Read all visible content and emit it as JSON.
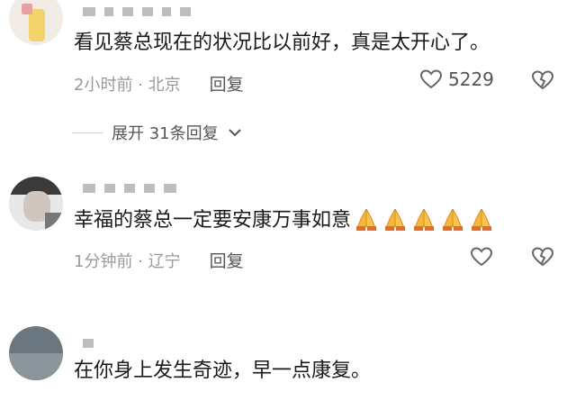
{
  "comments": [
    {
      "text": "看见蔡总现在的状况比以前好，真是太开心了。",
      "time": "2小时前 · 北京",
      "reply": "回复",
      "likes": "5229"
    },
    {
      "text": "幸福的蔡总一定要安康万事如意",
      "emoji_count": 5,
      "emoji": "folded-hands-icon",
      "time": "1分钟前 · 辽宁",
      "reply": "回复"
    },
    {
      "text": "在你身上发生奇迹，早一点康复。"
    }
  ],
  "expand_label": "展开 31条回复",
  "colors": {
    "text": "#1a1a1a",
    "meta": "#9a9a9a",
    "icon": "#555555"
  }
}
